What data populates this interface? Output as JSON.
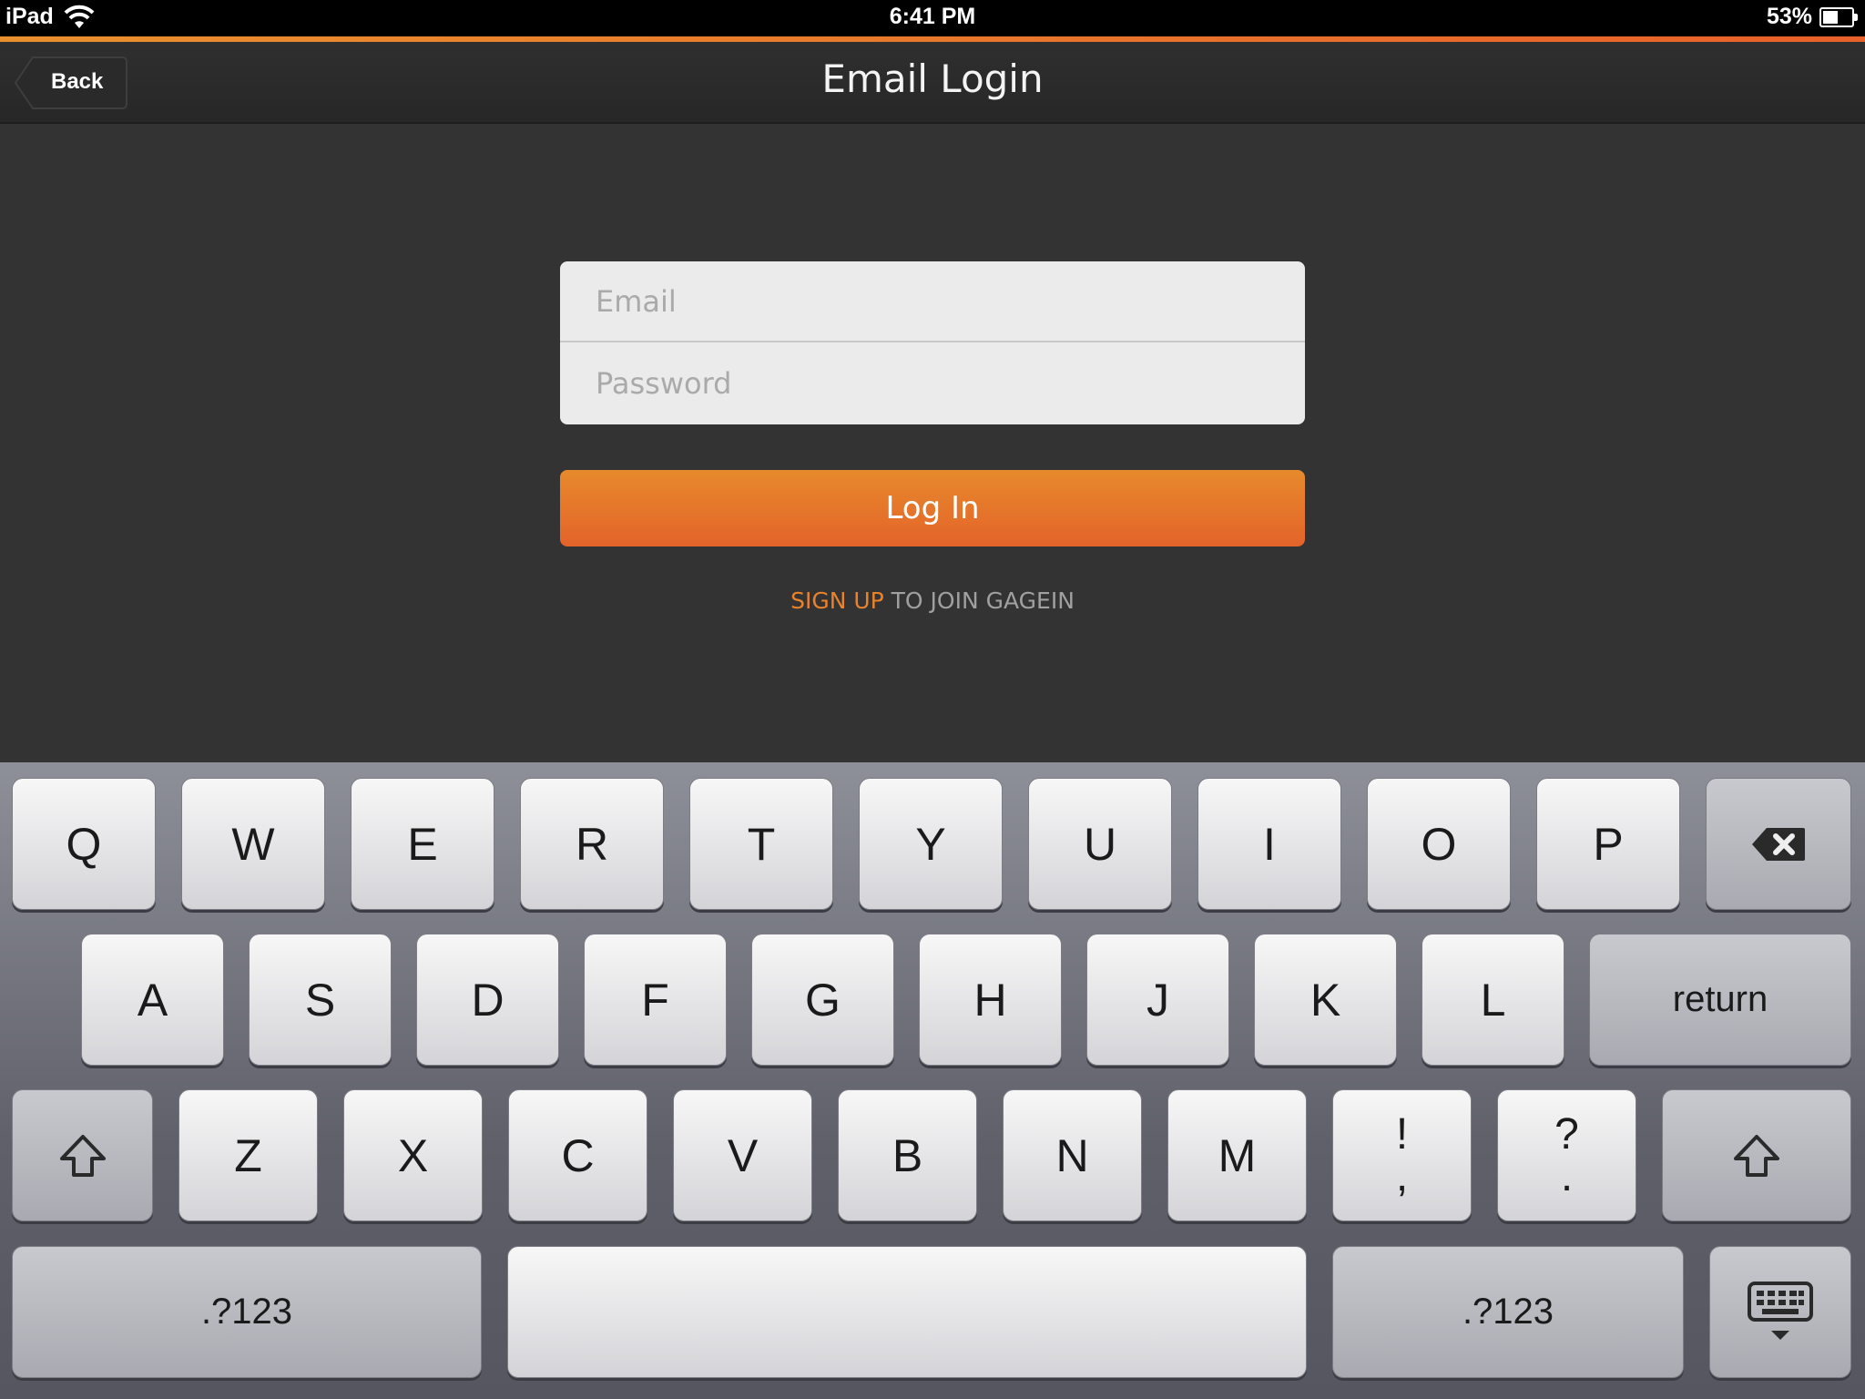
{
  "status_bar": {
    "device": "iPad",
    "time": "6:41 PM",
    "battery": "53%",
    "battery_level": 0.53
  },
  "nav": {
    "back_label": "Back",
    "title": "Email Login"
  },
  "form": {
    "email_placeholder": "Email",
    "password_placeholder": "Password"
  },
  "login_button": {
    "label": "Log In"
  },
  "signup": {
    "link": "SIGN UP",
    "text": " TO JOIN GAGEIN"
  },
  "colors": {
    "accent_start": "#e9902e",
    "accent_end": "#e8602a",
    "background": "#333333"
  },
  "keyboard": {
    "row1": [
      "Q",
      "W",
      "E",
      "R",
      "T",
      "Y",
      "U",
      "I",
      "O",
      "P"
    ],
    "row2": [
      "A",
      "S",
      "D",
      "F",
      "G",
      "H",
      "J",
      "K",
      "L"
    ],
    "return_label": "return",
    "row3": [
      "Z",
      "X",
      "C",
      "V",
      "B",
      "N",
      "M"
    ],
    "exclaim_top": "!",
    "exclaim_bottom": ",",
    "question_top": "?",
    "question_bottom": ".",
    "numbers_label": ".?123",
    "icons": [
      "backspace-icon",
      "shift-icon",
      "hide-keyboard-icon"
    ]
  }
}
